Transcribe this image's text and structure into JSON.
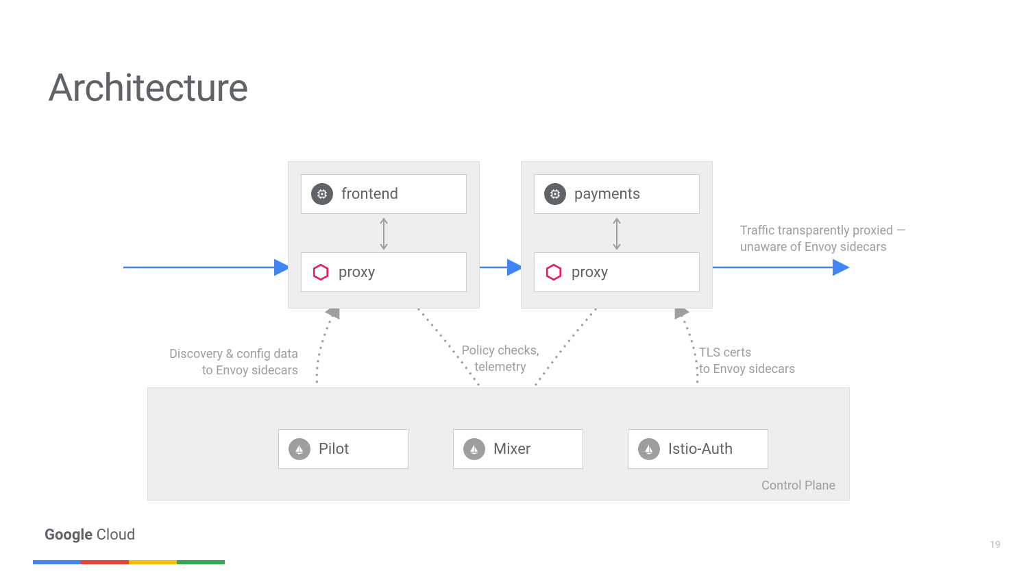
{
  "title": "Architecture",
  "pods": {
    "frontend": {
      "service": "frontend",
      "proxy": "proxy"
    },
    "payments": {
      "service": "payments",
      "proxy": "proxy"
    }
  },
  "controlPlane": {
    "label": "Control Plane",
    "components": {
      "pilot": "Pilot",
      "mixer": "Mixer",
      "auth": "Istio-Auth"
    }
  },
  "annotations": {
    "traffic": "Traffic transparently proxied — unaware of Envoy sidecars",
    "discovery": "Discovery & config data to Envoy sidecars",
    "policy": "Policy checks, telemetry",
    "tls": "TLS certs\nto Envoy sidecars"
  },
  "footer": {
    "google": "Google",
    "cloud": " Cloud",
    "pageNumber": "19"
  },
  "colors": {
    "blue": "#4285f4",
    "gray": "#9e9e9e",
    "magenta": "#e91e63"
  }
}
